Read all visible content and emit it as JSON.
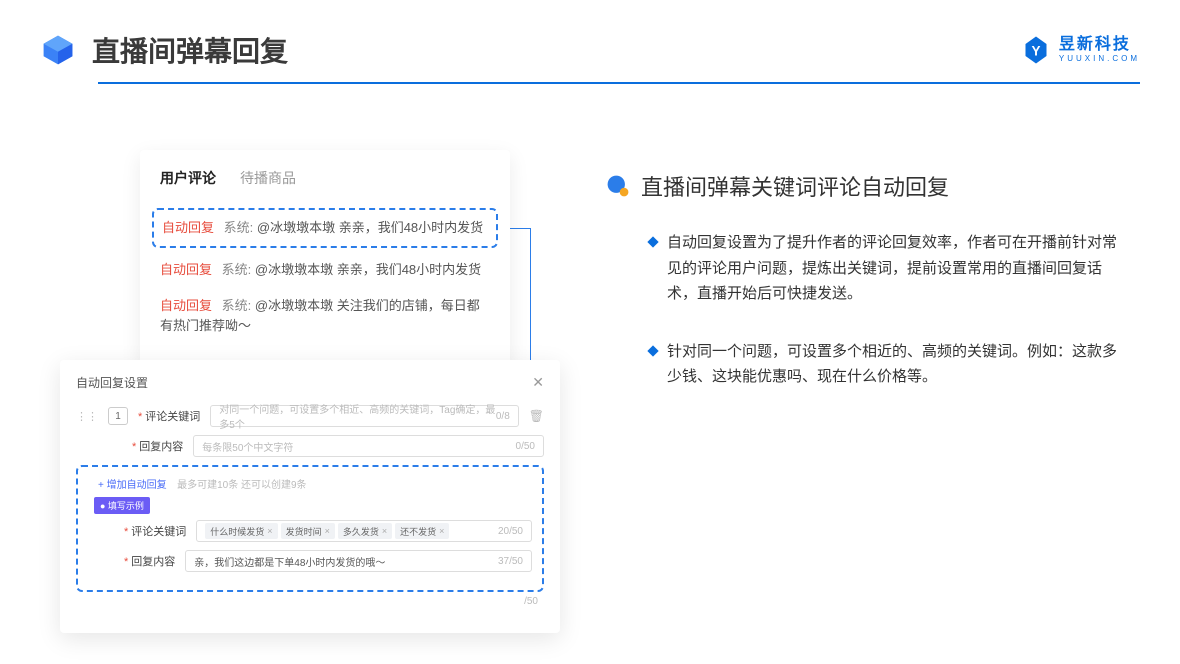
{
  "header": {
    "title": "直播间弹幕回复",
    "brand_cn": "昱新科技",
    "brand_en": "YUUXIN.COM"
  },
  "right": {
    "section_title": "直播间弹幕关键词评论自动回复",
    "bullet1": "自动回复设置为了提升作者的评论回复效率，作者可在开播前针对常见的评论用户问题，提炼出关键词，提前设置常用的直播间回复话术，直播开始后可快捷发送。",
    "bullet2": "针对同一个问题，可设置多个相近的、高频的关键词。例如：这款多少钱、这块能优惠吗、现在什么价格等。"
  },
  "comments": {
    "tab_active": "用户评论",
    "tab_other": "待播商品",
    "auto_label": "自动回复",
    "sys_label": "系统:",
    "row1": "@冰墩墩本墩 亲亲，我们48小时内发货",
    "row2": "@冰墩墩本墩 亲亲，我们48小时内发货",
    "row3": "@冰墩墩本墩 关注我们的店铺，每日都有热门推荐呦～"
  },
  "settings": {
    "title": "自动回复设置",
    "row_num": "1",
    "label_keyword": "评论关键词",
    "placeholder_keyword": "对同一个问题，可设置多个相近、高频的关键词，Tag确定，最多5个",
    "counter_keyword": "0/8",
    "label_reply": "回复内容",
    "placeholder_reply": "每条限50个中文字符",
    "counter_reply": "0/50",
    "add_link": "+ 增加自动回复",
    "add_hint": "最多可建10条 还可以创建9条",
    "example_badge": "● 填写示例",
    "ex_label_kw": "评论关键词",
    "ex_tags": [
      "什么时候发货",
      "发货时间",
      "多久发货",
      "还不发货"
    ],
    "ex_kw_counter": "20/50",
    "ex_label_reply": "回复内容",
    "ex_reply": "亲，我们这边都是下单48小时内发货的哦～",
    "ex_reply_counter": "37/50",
    "extra_counter": "/50"
  }
}
